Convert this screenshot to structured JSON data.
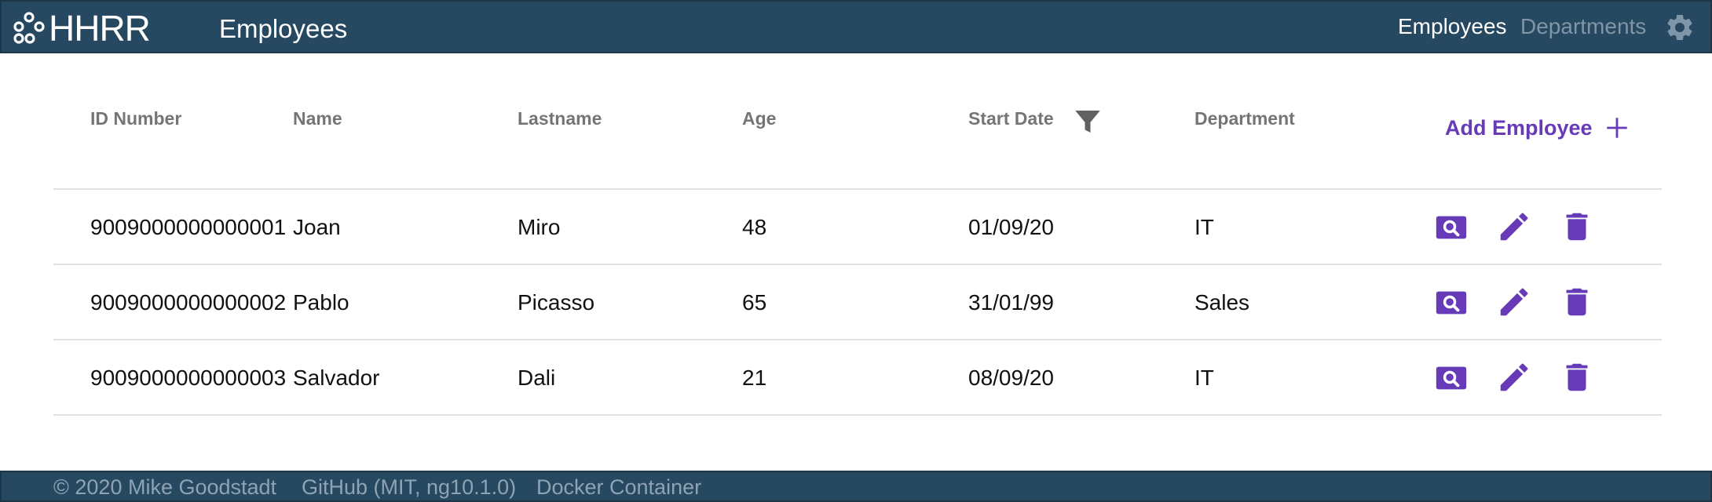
{
  "app": {
    "brand": "HHRR",
    "page_title": "Employees"
  },
  "nav": {
    "employees": "Employees",
    "departments": "Departments",
    "settings_icon": "gear-icon"
  },
  "table": {
    "headers": {
      "id": "ID Number",
      "name": "Name",
      "lastname": "Lastname",
      "age": "Age",
      "start_date": "Start Date",
      "department": "Department"
    },
    "add_label": "Add Employee",
    "rows": [
      {
        "id": "9009000000000001",
        "name": "Joan",
        "lastname": "Miro",
        "age": "48",
        "start_date": "01/09/20",
        "department": "IT"
      },
      {
        "id": "9009000000000002",
        "name": "Pablo",
        "lastname": "Picasso",
        "age": "65",
        "start_date": "31/01/99",
        "department": "Sales"
      },
      {
        "id": "9009000000000003",
        "name": "Salvador",
        "lastname": "Dali",
        "age": "21",
        "start_date": "08/09/20",
        "department": "IT"
      }
    ]
  },
  "footer": {
    "copyright": "© 2020 Mike Goodstadt",
    "github": "GitHub (MIT, ng10.1.0)",
    "docker": "Docker Container"
  },
  "colors": {
    "header_bg": "#264860",
    "accent": "#673ab7",
    "muted_nav": "#7f96a8",
    "footer_text": "#8ea3b3"
  }
}
